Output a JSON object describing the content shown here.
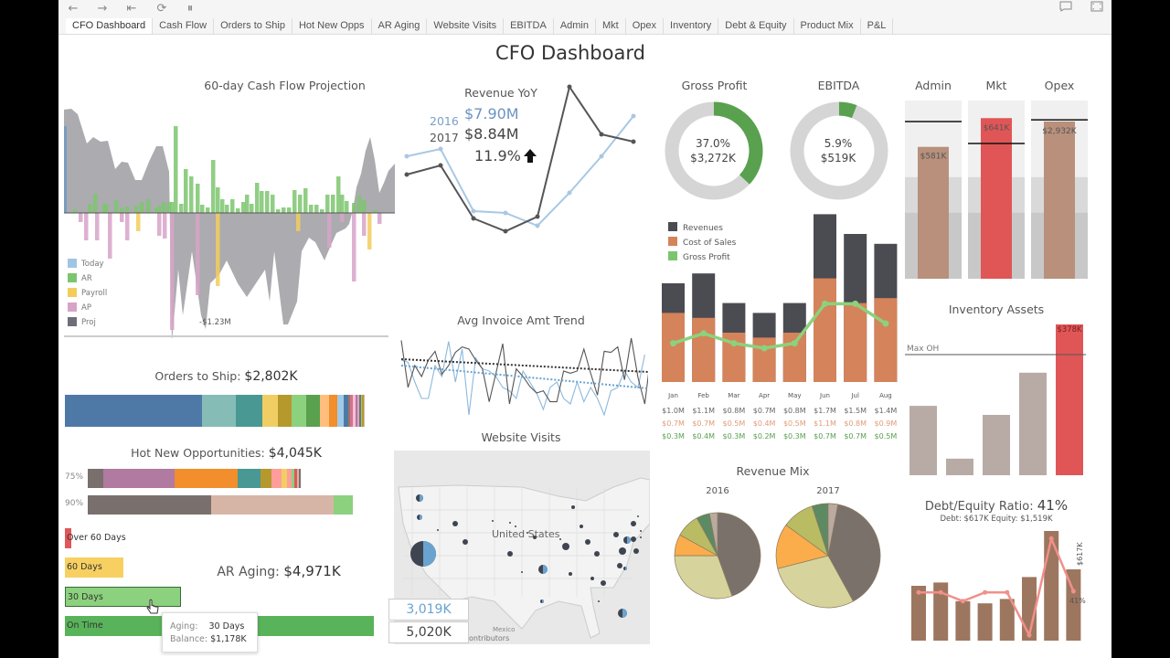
{
  "toolbar": {
    "buttons": [
      {
        "name": "back-icon",
        "glyph": "←"
      },
      {
        "name": "forward-icon",
        "glyph": "→"
      },
      {
        "name": "revert-icon",
        "glyph": "⇤"
      },
      {
        "name": "refresh-data-icon",
        "glyph": "⟳"
      },
      {
        "name": "pause-updates-icon",
        "glyph": "⏸"
      }
    ],
    "right_buttons": [
      {
        "name": "comment-icon",
        "glyph": "💬"
      },
      {
        "name": "fullscreen-icon",
        "glyph": "⛶"
      }
    ]
  },
  "tabs": [
    "CFO Dashboard",
    "Cash Flow",
    "Orders to Ship",
    "Hot New Opps",
    "AR Aging",
    "Website Visits",
    "EBITDA",
    "Admin",
    "Mkt",
    "Opex",
    "Inventory",
    "Debt & Equity",
    "Product Mix",
    "P&L"
  ],
  "active_tab": 0,
  "dashboard_title": "CFO Dashboard",
  "cashflow": {
    "title": "60-day Cash Flow Projection",
    "min_label": "-$1.23M",
    "legend": [
      {
        "label": "Today",
        "color": "#a0c4e4"
      },
      {
        "label": "AR",
        "color": "#7cc56f"
      },
      {
        "label": "Payroll",
        "color": "#f2cd5c"
      },
      {
        "label": "AP",
        "color": "#d7a3c8"
      },
      {
        "label": "Proj",
        "color": "#6e6e78"
      }
    ]
  },
  "revenue_yoy": {
    "title": "Revenue YoY",
    "y2016_label": "2016",
    "y2016_value": "$7.90M",
    "y2017_label": "2017",
    "y2017_value": "$8.84M",
    "change": "11.9%",
    "series_2016": [
      0.62,
      0.66,
      0.32,
      0.31,
      0.24,
      0.42,
      0.62,
      0.84
    ],
    "series_2017": [
      0.52,
      0.57,
      0.28,
      0.21,
      0.29,
      1.0,
      0.74,
      0.7
    ],
    "color_2016": "#a8c8e4",
    "color_2017": "#555558"
  },
  "avg_invoice": {
    "title": "Avg Invoice Amt Trend"
  },
  "website_visits": {
    "title": "Website Visits",
    "map_label": "United States",
    "mexico_label": "Mexico",
    "attribution": "ontributors",
    "value_2016": "3,019K",
    "value_2017": "5,020K"
  },
  "gross_profit": {
    "title": "Gross Profit",
    "pct": "37.0%",
    "value": "$3,272K",
    "fraction": 0.37
  },
  "ebitda": {
    "title": "EBITDA",
    "pct": "5.9%",
    "value": "$519K",
    "fraction": 0.059
  },
  "expenses": [
    {
      "title": "Admin",
      "value": "$581K",
      "fill": 0.78,
      "target": 0.93,
      "color": "#b8907c"
    },
    {
      "title": "Mkt",
      "value": "$641K",
      "fill": 0.95,
      "target": 0.8,
      "color": "#e05656"
    },
    {
      "title": "Opex",
      "value": "$2,932K",
      "fill": 0.93,
      "target": 0.94,
      "color": "#b8907c"
    }
  ],
  "pl_chart": {
    "legend": [
      {
        "label": "Revenues",
        "color": "#4b4b52"
      },
      {
        "label": "Cost of Sales",
        "color": "#d4835a"
      },
      {
        "label": "Gross Profit",
        "color": "#7cc56f"
      }
    ],
    "months": [
      "Jan",
      "Feb",
      "Mar",
      "Apr",
      "May",
      "Jun",
      "Jul",
      "Aug"
    ],
    "revenues": [
      "$1.0M",
      "$1.1M",
      "$0.8M",
      "$0.7M",
      "$0.8M",
      "$1.7M",
      "$1.5M",
      "$1.4M"
    ],
    "cost_of_sales": [
      "$0.7M",
      "$0.7M",
      "$0.5M",
      "$0.4M",
      "$0.5M",
      "$1.1M",
      "$0.8M",
      "$0.9M"
    ],
    "gross_profit": [
      "$0.3M",
      "$0.4M",
      "$0.3M",
      "$0.2M",
      "$0.3M",
      "$0.7M",
      "$0.7M",
      "$0.5M"
    ],
    "rev_values": [
      1.0,
      1.1,
      0.8,
      0.7,
      0.8,
      1.7,
      1.5,
      1.4
    ],
    "cos_values": [
      0.7,
      0.65,
      0.5,
      0.45,
      0.5,
      1.05,
      0.8,
      0.85
    ],
    "gp_values": [
      0.3,
      0.4,
      0.3,
      0.25,
      0.3,
      0.7,
      0.7,
      0.5
    ]
  },
  "inventory": {
    "title": "Inventory Assets",
    "max_label": "Max OH",
    "highlight_value": "$378K",
    "values": [
      0.46,
      0.11,
      0.4,
      0.68,
      1.0
    ],
    "max_oh": 0.8
  },
  "debt_equity": {
    "title": "Debt/Equity Ratio:",
    "ratio": "41%",
    "subtitle": "Debt: $617K  Equity: $1,519K",
    "bar_label": "$617K",
    "line_label": "41%",
    "bars": [
      0.5,
      0.53,
      0.36,
      0.34,
      0.38,
      0.58,
      1.0,
      0.65
    ],
    "line": [
      0.44,
      0.44,
      0.36,
      0.44,
      0.44,
      0.05,
      0.93,
      0.45
    ]
  },
  "orders_to_ship": {
    "title": "Orders to Ship:",
    "value": "$2,802K",
    "segments": [
      {
        "w": 0.445,
        "c": "#4e79a7"
      },
      {
        "w": 0.108,
        "c": "#86bcb6"
      },
      {
        "w": 0.085,
        "c": "#499894"
      },
      {
        "w": 0.05,
        "c": "#f1ce63"
      },
      {
        "w": 0.047,
        "c": "#b6992d"
      },
      {
        "w": 0.047,
        "c": "#8cd17d"
      },
      {
        "w": 0.043,
        "c": "#59a14f"
      },
      {
        "w": 0.03,
        "c": "#ffbe7d"
      },
      {
        "w": 0.027,
        "c": "#f28e2b"
      },
      {
        "w": 0.021,
        "c": "#a0cbe8"
      },
      {
        "w": 0.013,
        "c": "#4e79a7"
      },
      {
        "w": 0.008,
        "c": "#9d7660"
      },
      {
        "w": 0.008,
        "c": "#d37295"
      },
      {
        "w": 0.008,
        "c": "#fabfd2"
      },
      {
        "w": 0.007,
        "c": "#b07aa1"
      },
      {
        "w": 0.006,
        "c": "#d4a6c8"
      },
      {
        "w": 0.005,
        "c": "#79706e"
      },
      {
        "w": 0.005,
        "c": "#8cd17d"
      },
      {
        "w": 0.004,
        "c": "#b6992d"
      },
      {
        "w": 0.004,
        "c": "#d7b5a6"
      }
    ]
  },
  "hot_opps": {
    "title": "Hot New Opportunities:",
    "value": "$4,045K",
    "rows": [
      {
        "label": "75%",
        "segments": [
          {
            "w": 0.053,
            "c": "#79706e"
          },
          {
            "w": 0.25,
            "c": "#b07aa1"
          },
          {
            "w": 0.222,
            "c": "#f28e2b"
          },
          {
            "w": 0.078,
            "c": "#499894"
          },
          {
            "w": 0.04,
            "c": "#b6992d"
          },
          {
            "w": 0.033,
            "c": "#ff9d9a"
          },
          {
            "w": 0.02,
            "c": "#f1ce63"
          },
          {
            "w": 0.015,
            "c": "#ff9d9a"
          },
          {
            "w": 0.01,
            "c": "#8cd17d"
          },
          {
            "w": 0.01,
            "c": "#e15759"
          },
          {
            "w": 0.008,
            "c": "#d7b5a6"
          },
          {
            "w": 0.005,
            "c": "#79706e"
          }
        ]
      },
      {
        "label": "90%",
        "segments": [
          {
            "w": 0.43,
            "c": "#79706e"
          },
          {
            "w": 0.43,
            "c": "#d7b5a6"
          },
          {
            "w": 0.065,
            "c": "#8cd17d"
          }
        ]
      }
    ]
  },
  "ar_aging": {
    "title": "AR Aging:",
    "value": "$4,971K",
    "buckets": [
      {
        "label": "Over 60 Days",
        "fraction": 0.022,
        "color": "#e15759"
      },
      {
        "label": "60 Days",
        "fraction": 0.19,
        "color": "#f7d061"
      },
      {
        "label": "30 Days",
        "fraction": 0.375,
        "color": "#8cd17d"
      },
      {
        "label": "On Time",
        "fraction": 1.0,
        "color": "#59b35a"
      }
    ],
    "tooltip": {
      "aging_label": "Aging:",
      "aging_value": "30 Days",
      "balance_label": "Balance:",
      "balance_value": "$1,178K"
    }
  },
  "revenue_mix": {
    "title": "Revenue Mix",
    "pies": [
      {
        "label": "2016",
        "slices": [
          {
            "v": 0.445,
            "c": "#7a716b"
          },
          {
            "v": 0.305,
            "c": "#d7d39c"
          },
          {
            "v": 0.08,
            "c": "#fbac4b"
          },
          {
            "v": 0.09,
            "c": "#b9bc63"
          },
          {
            "v": 0.05,
            "c": "#5d8a63"
          },
          {
            "v": 0.03,
            "c": "#bbaaa0"
          }
        ]
      },
      {
        "label": "2017",
        "slices": [
          {
            "v": 0.42,
            "c": "#7a716b"
          },
          {
            "v": 0.29,
            "c": "#d7d39c"
          },
          {
            "v": 0.14,
            "c": "#fbac4b"
          },
          {
            "v": 0.1,
            "c": "#b9bc63"
          },
          {
            "v": 0.05,
            "c": "#5d8a63"
          },
          {
            "v": 0.03,
            "c": "#bbaaa0"
          }
        ]
      }
    ]
  }
}
